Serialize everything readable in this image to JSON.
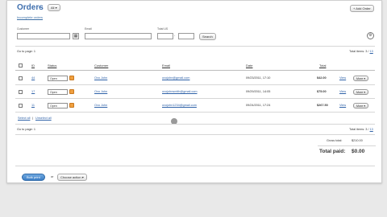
{
  "header": {
    "title": "Orders",
    "filter_label": "All",
    "subtitle_link": "Incomplete orders",
    "add_button": "+ Add Order"
  },
  "search": {
    "customer_label": "Customer",
    "email_label": "Email",
    "total_label": "Total US",
    "customer_value": "",
    "email_value": "",
    "total_from": "",
    "total_to": "",
    "search_button": "Search"
  },
  "pagination": {
    "top_go_to_page": "Go to page: 1",
    "top_total_items_label": "Total items: 3 /",
    "top_total_items_link": "13",
    "bottom_go_to_page": "Go to page: 1",
    "bottom_total_items_label": "Total items: 3 /",
    "bottom_total_items_link": "13"
  },
  "table": {
    "columns": [
      "ID",
      "Status",
      "Customer",
      "Email",
      "Date",
      "Total"
    ],
    "rows": [
      {
        "id": "44",
        "status": "Open",
        "customer": "Ovo John",
        "email": "ovojohn@gmail.com",
        "date": "09/23/2011, 17:10",
        "total": "$42.00",
        "view": "View",
        "more": "More"
      },
      {
        "id": "17",
        "status": "Open",
        "customer": "Ovo John",
        "email": "ovojohnsmith@gmail.com",
        "date": "09/29/2011, 14:05",
        "total": "$75.00",
        "view": "View",
        "more": "More"
      },
      {
        "id": "11",
        "status": "Open",
        "customer": "Ovo John",
        "email": "ovojohn1234@gmail.com",
        "date": "09/24/2011, 17:24",
        "total": "$267.50",
        "view": "View",
        "more": "More"
      }
    ],
    "select_all": "Select all",
    "unselect_all": "Unselect all"
  },
  "totals": {
    "gross_label": "Gross total:",
    "gross_value": "$210.00",
    "paid_label": "Total paid:",
    "paid_value": "$0.00"
  },
  "footer": {
    "primary_button": "Bulk print",
    "or_text": "or",
    "choose_action": "Choose action"
  },
  "colors": {
    "title_blue": "#3f6fae",
    "link_blue": "#2f62a8",
    "status_orange": "#f0a040",
    "primary_button": "#3d7fc6"
  }
}
